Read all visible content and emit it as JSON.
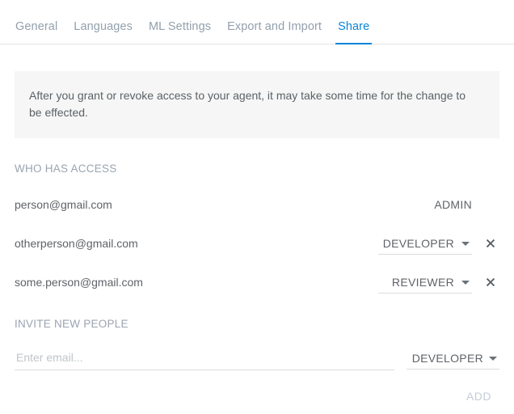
{
  "tabs": [
    {
      "label": "General",
      "active": false
    },
    {
      "label": "Languages",
      "active": false
    },
    {
      "label": "ML Settings",
      "active": false
    },
    {
      "label": "Export and Import",
      "active": false
    },
    {
      "label": "Share",
      "active": true
    }
  ],
  "banner": {
    "text": "After you grant or revoke access to your agent, it may take some time for the change to be effected."
  },
  "who_has_access": {
    "title": "WHO HAS ACCESS",
    "rows": [
      {
        "email": "person@gmail.com",
        "role": "ADMIN",
        "editable": false,
        "removable": false
      },
      {
        "email": "otherperson@gmail.com",
        "role": "DEVELOPER",
        "editable": true,
        "removable": true
      },
      {
        "email": "some.person@gmail.com",
        "role": "REVIEWER",
        "editable": true,
        "removable": true
      }
    ]
  },
  "invite": {
    "title": "INVITE NEW PEOPLE",
    "email_placeholder": "Enter email...",
    "email_value": "",
    "role": "DEVELOPER",
    "add_label": "ADD"
  },
  "colors": {
    "accent": "#0b84d9",
    "tab_inactive": "#93a0ad",
    "body_text": "#5f6368",
    "muted_label": "#9aa4b0",
    "banner_bg": "#f6f6f6",
    "underline": "#dcdcdc",
    "add_disabled": "#c2cdd8"
  }
}
